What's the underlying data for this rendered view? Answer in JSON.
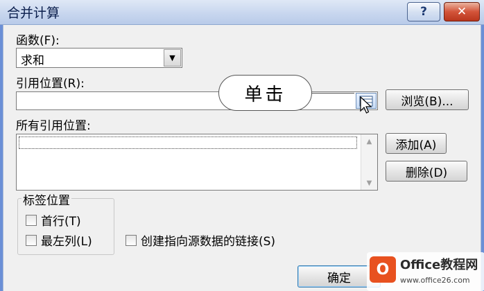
{
  "window": {
    "title": "合并计算",
    "help_label": "?",
    "close_label": "✕"
  },
  "function": {
    "label": "函数(F):",
    "selected": "求和"
  },
  "reference": {
    "label": "引用位置(R):",
    "value": "",
    "browse_label": "浏览(B)..."
  },
  "all_references": {
    "label": "所有引用位置:",
    "items": [],
    "add_label": "添加(A)",
    "delete_label": "删除(D)"
  },
  "label_position": {
    "group_title": "标签位置",
    "top_row_label": "首行(T)",
    "top_row_checked": false,
    "left_column_label": "最左列(L)",
    "left_column_checked": false
  },
  "create_links": {
    "label": "创建指向源数据的链接(S)",
    "checked": false
  },
  "footer": {
    "ok_label": "确定"
  },
  "annotation": {
    "callout_text": "单击"
  },
  "watermark": {
    "logo_text": "O",
    "title": "Office教程网",
    "url": "www.office26.com"
  }
}
